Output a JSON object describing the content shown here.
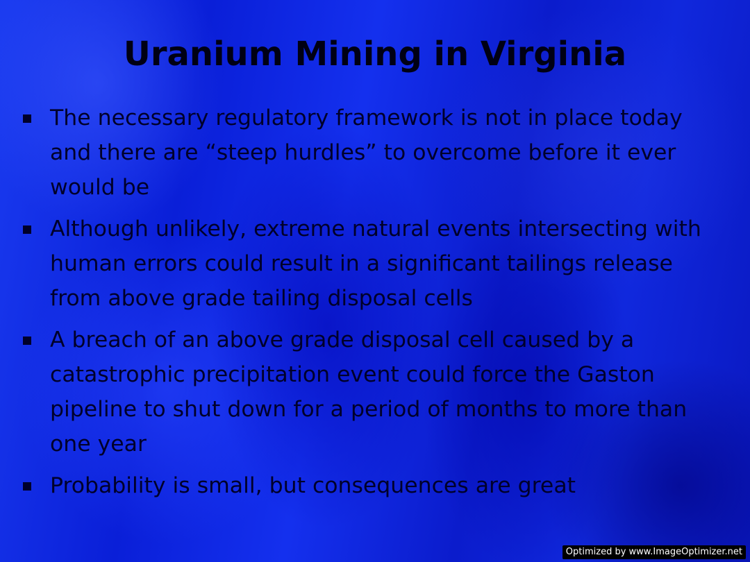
{
  "slide": {
    "title": "Uranium Mining in Virginia",
    "bullets": [
      "The necessary regulatory framework is not in place today and there are “steep hurdles” to overcome before it ever would be",
      "Although unlikely, extreme natural events intersecting with human errors could result in a significant tailings release from above grade tailing disposal cells",
      "A breach of an above grade disposal cell caused by a catastrophic precipitation event could force the Gaston pipeline to shut down for a period of months to more than one year",
      "Probability is small, but consequences are great"
    ],
    "bullet_icon": "square-bullet-icon"
  },
  "watermark": "Optimized by www.ImageOptimizer.net",
  "colors": {
    "background": "#1430ee",
    "text": "#00002a"
  }
}
